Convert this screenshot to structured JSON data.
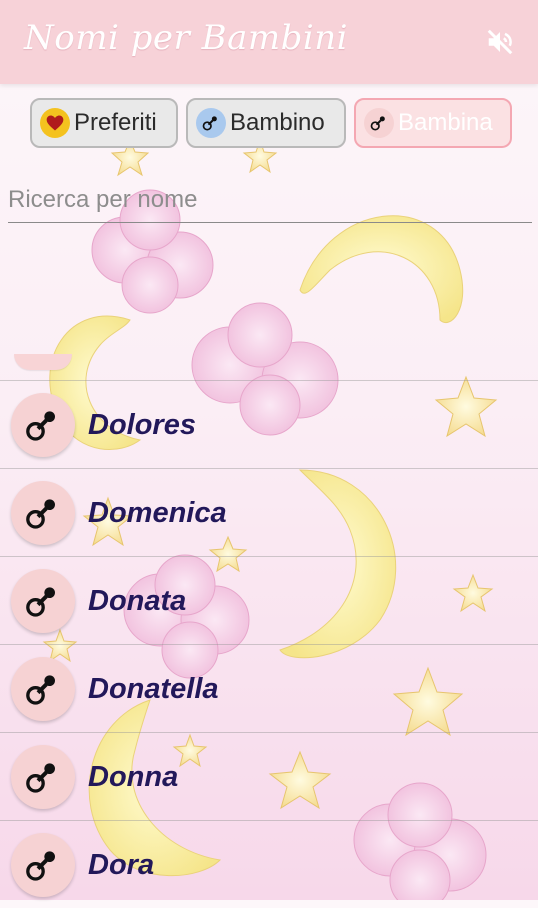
{
  "app": {
    "title": "Nomi per Bambini",
    "mute_icon": "speaker-muted-icon"
  },
  "tabs": [
    {
      "label": "Preferiti",
      "icon": "heart-icon",
      "icon_bg": "#f4c21f",
      "selected": false
    },
    {
      "label": "Bambino",
      "icon": "pacifier-icon",
      "icon_bg": "#a9c9ee",
      "selected": false
    },
    {
      "label": "Bambina",
      "icon": "pacifier-icon",
      "icon_bg": "#f6d2d3",
      "selected": true
    }
  ],
  "search": {
    "placeholder": "Ricerca per nome",
    "value": ""
  },
  "names": [
    {
      "name": "Dolores",
      "icon": "pacifier-icon"
    },
    {
      "name": "Domenica",
      "icon": "pacifier-icon"
    },
    {
      "name": "Donata",
      "icon": "pacifier-icon"
    },
    {
      "name": "Donatella",
      "icon": "pacifier-icon"
    },
    {
      "name": "Donna",
      "icon": "pacifier-icon"
    },
    {
      "name": "Dora",
      "icon": "pacifier-icon"
    }
  ],
  "colors": {
    "appbar": "#f7d2d8",
    "name_text": "#22185a",
    "avatar_bg": "#f6d2d3"
  }
}
